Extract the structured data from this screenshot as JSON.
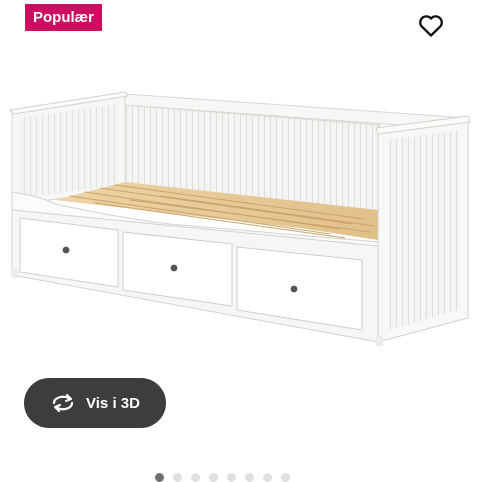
{
  "badge": {
    "label": "Populær",
    "color": "#cc0e63"
  },
  "favorite": {
    "icon": "heart-outline-icon"
  },
  "product_image": {
    "subject": "white daybed with three drawers"
  },
  "view_3d": {
    "label": "Vis i 3D",
    "icon": "rotate-3d-icon"
  },
  "carousel": {
    "total": 8,
    "active_index": 0
  }
}
